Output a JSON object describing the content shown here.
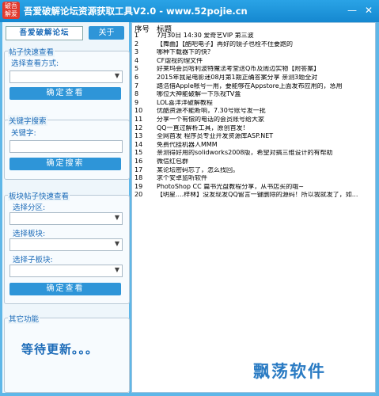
{
  "app": {
    "logo_text": "破吾\n解爱",
    "title": "吾爱破解论坛资源获取工具V2.0 - www.52pojie.cn",
    "minimize": "—",
    "close": "✕"
  },
  "left": {
    "site_button": "吾爱破解论坛",
    "about_button": "关于",
    "quick_view": {
      "group_label": "帖子快速查看",
      "method_label": "选择查看方式:",
      "select_value": "",
      "confirm": "确定查看"
    },
    "keyword_search": {
      "group_label": "关键字搜索",
      "keyword_label": "关键字:",
      "keyword_value": "",
      "confirm": "确定搜索"
    },
    "board_view": {
      "group_label": "板块帖子快速查看",
      "zone_label": "选择分区:",
      "zone_value": "",
      "board_label": "选择板块:",
      "board_value": "",
      "subboard_label": "选择子板块:",
      "subboard_value": "",
      "confirm": "确定查看"
    },
    "other": {
      "group_label": "其它功能",
      "waiting": "等待更新。。。"
    }
  },
  "list": {
    "col_seq": "序号",
    "col_title": "标题",
    "rows": [
      {
        "num": "1",
        "title": "7月30日 14:30  爱奇艺VIP 第三波"
      },
      {
        "num": "2",
        "title": "【舞曲】【酷吧电子】再好的镜子也栓不住要跑的"
      },
      {
        "num": "3",
        "title": "哪种下载器下的快？"
      },
      {
        "num": "4",
        "title": "CF虐视的理文件"
      },
      {
        "num": "5",
        "title": "好莱坞会员哈利波特魔法考堂送Q币及周边实物【附答案】"
      },
      {
        "num": "6",
        "title": "2015年我是电影迷08月第1期正确答案分享 亲测3题全对"
      },
      {
        "num": "7",
        "title": "踏浩借Apple帐号一用，要能够在Appstore上面发布应用的，急用"
      },
      {
        "num": "8",
        "title": "哪位大神能破解一下乐视TV盒"
      },
      {
        "num": "9",
        "title": "LOL喜洋洋破解教程"
      },
      {
        "num": "10",
        "title": "优酷资源不能断响，7.30号账号发一批"
      },
      {
        "num": "11",
        "title": "分享一个有偿的电话的会员账号给大家"
      },
      {
        "num": "12",
        "title": "QQ一直过解析工具，原创首发！"
      },
      {
        "num": "13",
        "title": "全网首发 程序员专业开发资源库ASP.NET"
      },
      {
        "num": "14",
        "title": "免费代挂机器人MMM"
      },
      {
        "num": "15",
        "title": "亲测得好用的solidworks2008版，希望对搞三维设计的有帮助"
      },
      {
        "num": "16",
        "title": "微信红包群"
      },
      {
        "num": "17",
        "title": "某论坛密码忘了，怎么找回。"
      },
      {
        "num": "18",
        "title": "求个安卓监听软件"
      },
      {
        "num": "19",
        "title": "PhotoShop CC 篇书光盘教程分享，从书店买的哦~"
      },
      {
        "num": "20",
        "title": "【明星....梓林】没发现发QQ留言一键删除的源码！所以我就发了，如..."
      }
    ]
  },
  "watermark": "飘荡软件"
}
